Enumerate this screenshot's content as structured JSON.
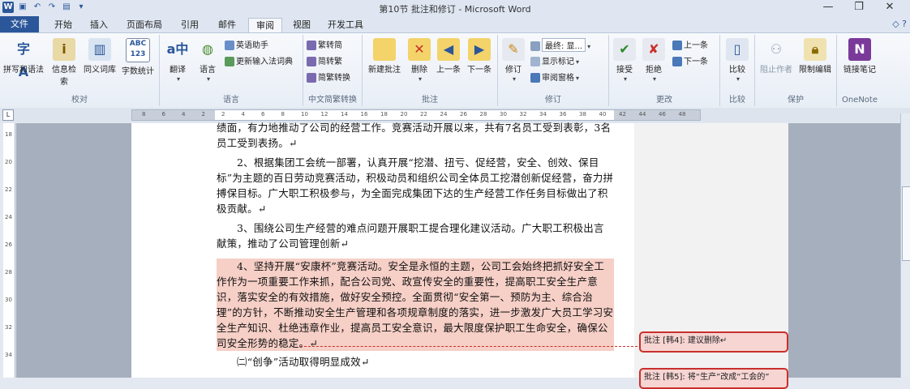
{
  "window": {
    "title": "第10节 批注和修订 - Microsoft Word",
    "app_icon": "W"
  },
  "tabs": [
    {
      "label": "文件",
      "active": false
    },
    {
      "label": "开始",
      "active": false
    },
    {
      "label": "插入",
      "active": false
    },
    {
      "label": "页面布局",
      "active": false
    },
    {
      "label": "引用",
      "active": false
    },
    {
      "label": "邮件",
      "active": false
    },
    {
      "label": "审阅",
      "active": true
    },
    {
      "label": "视图",
      "active": false
    },
    {
      "label": "开发工具",
      "active": false
    }
  ],
  "ribbon": {
    "proofing": {
      "caption": "校对",
      "spelling": "拼写和语法",
      "research": "信息检索",
      "thesaurus": "同义词库",
      "wordcount": "字数统计",
      "abc": "ABC",
      "num": "123"
    },
    "language": {
      "caption": "语言",
      "translate": "翻译",
      "language": "语言",
      "english_assistant": "英语助手",
      "update_ime": "更新输入法词典"
    },
    "chinese": {
      "caption": "中文简繁转换",
      "to_simplified": "繁转简",
      "to_traditional": "简转繁",
      "convert": "简繁转换"
    },
    "comments": {
      "caption": "批注",
      "new": "新建批注",
      "delete": "删除",
      "prev": "上一条",
      "next": "下一条"
    },
    "tracking": {
      "caption": "修订",
      "track": "修订",
      "display_combo": "最终: 显...",
      "show_markup": "显示标记",
      "review_pane": "审阅窗格"
    },
    "changes": {
      "caption": "更改",
      "accept": "接受",
      "reject": "拒绝",
      "prev": "上一条",
      "next": "下一条"
    },
    "compare": {
      "caption": "比较",
      "compare": "比较"
    },
    "protect": {
      "caption": "保护",
      "block_authors": "阻止作者",
      "restrict": "限制编辑"
    },
    "onenote": {
      "caption": "OneNote",
      "linked_notes": "链接笔记"
    }
  },
  "ruler": {
    "numbers": [
      "8",
      "6",
      "4",
      "2",
      "2",
      "4",
      "6",
      "8",
      "10",
      "12",
      "14",
      "16",
      "18",
      "20",
      "22",
      "24",
      "26",
      "28",
      "30",
      "32",
      "34",
      "36",
      "38",
      "40",
      "42",
      "44",
      "46",
      "48"
    ],
    "vnumbers": [
      "18",
      "20",
      "22",
      "24",
      "26",
      "28",
      "30",
      "32",
      "34"
    ],
    "corner": "L"
  },
  "document": {
    "p0": "绩面，有力地推动了公司的经营工作。竞赛活动开展以来，共有7名员工受到表彰，3名员工受到表扬。↵",
    "p2": "2、根据集团工会统一部署，认真开展“挖潜、扭亏、促经营，安全、创效、保目标”为主题的百日劳动竞赛活动，积极动员和组织公司全体员工挖潜创新促经营，奋力拼搏保目标。广大职工积极参与，为全面完成集团下达的生产经营工作任务目标做出了积极贡献。↵",
    "p3": "3、围绕公司生产经营的难点问题开展职工提合理化建议活动。广大职工积极出言献策，推动了公司管理创新↵",
    "p4": "4、坚持开展“安康杯”竞赛活动。安全是永恒的主题，公司工会始终把抓好安全工作作为一项重要工作来抓，配合公司党、政宣传安全的重要性，提高职工安全生产意识，落实安全的有效措施，做好安全预控。全面贯彻“安全第一、预防为主、综合治理”的方针，不断推动安全生产管理和各项规章制度的落实，进一步激发广大员工学习安全生产知识、杜绝违章作业，提高员工安全意识，最大限度保护职工生命安全，确保公司安全形势的稳定。↵",
    "p5": "㈡“创争”活动取得明显成效↵"
  },
  "comments": [
    {
      "label": "批注 [韩4]: 建议删除↵"
    },
    {
      "label": "批注 [韩5]: 将“生产”改成“工会的”"
    }
  ]
}
